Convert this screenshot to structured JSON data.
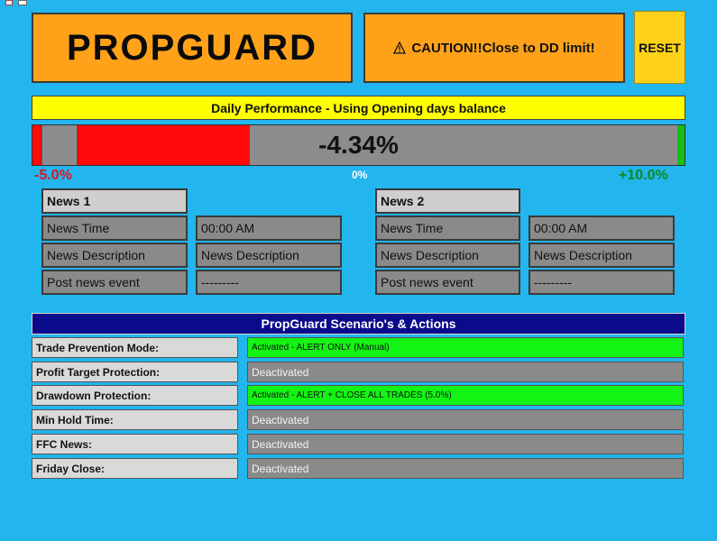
{
  "header": {
    "logo": "PROPGUARD",
    "caution": "CAUTION!!Close to DD limit!",
    "reset_label": "RESET"
  },
  "performance": {
    "title": "Daily Performance - Using Opening days balance",
    "value": "-4.34%",
    "value_num": -4.34,
    "min_label": "-5.0%",
    "zero_label": "0%",
    "max_label": "+10.0%"
  },
  "news": [
    {
      "title": "News 1",
      "rows": [
        {
          "label": "News Time",
          "value": "00:00 AM"
        },
        {
          "label": "News Description",
          "value": "News Description"
        },
        {
          "label": "Post news event",
          "value": "---------"
        }
      ]
    },
    {
      "title": "News 2",
      "rows": [
        {
          "label": "News Time",
          "value": "00:00 AM"
        },
        {
          "label": "News Description",
          "value": "News Description"
        },
        {
          "label": "Post news event",
          "value": "---------"
        }
      ]
    }
  ],
  "scenarios": {
    "title": "PropGuard Scenario's & Actions",
    "rows": [
      {
        "label": "Trade Prevention Mode:",
        "status": "Activated - ALERT ONLY (Manual)",
        "active": true
      },
      {
        "label": "Profit Target Protection:",
        "status": "Deactivated",
        "active": false
      },
      {
        "label": "Drawdown Protection:",
        "status": "Activated - ALERT + CLOSE ALL TRADES (5.0%)",
        "active": true
      },
      {
        "label": "Min Hold Time:",
        "status": "Deactivated",
        "active": false
      },
      {
        "label": "FFC News:",
        "status": "Deactivated",
        "active": false
      },
      {
        "label": "Friday Close:",
        "status": "Deactivated",
        "active": false
      }
    ]
  },
  "colors": {
    "background": "#22b5ee",
    "orange": "#ffa21a",
    "banner_yellow": "#ffff00",
    "negative_red": "#ff0a0a",
    "positive_green": "#15c015",
    "active_green": "#14f414",
    "navy": "#0a0a8a"
  }
}
